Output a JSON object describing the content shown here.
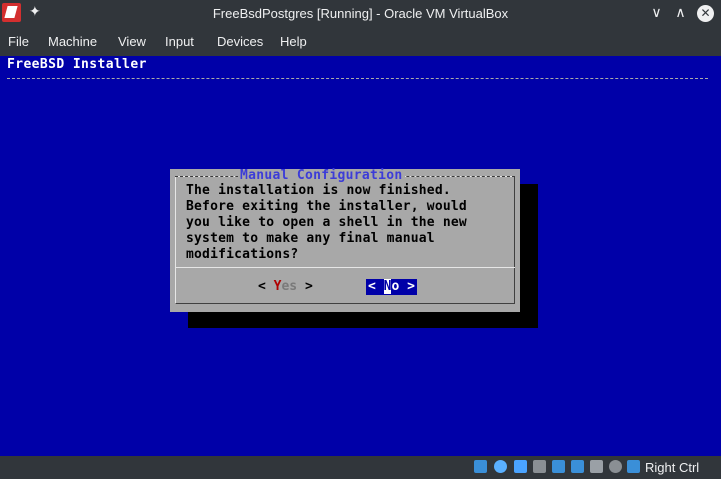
{
  "window": {
    "title": "FreeBsdPostgres [Running] - Oracle VM VirtualBox",
    "min_glyph": "∨",
    "max_glyph": "∧",
    "close_glyph": "✕",
    "pin_glyph": "✦"
  },
  "menu": {
    "items": [
      "File",
      "Machine",
      "View",
      "Input",
      "Devices",
      "Help"
    ]
  },
  "vm": {
    "header": "FreeBSD Installer",
    "dialog": {
      "title": "Manual Configuration",
      "message": "The installation is now finished.\nBefore exiting the installer, would\nyou like to open a shell in the new\nsystem to make any final manual\nmodifications?",
      "yes_open": "<",
      "yes_hot": "Y",
      "yes_rest": "es",
      "yes_close": ">",
      "no_open": "<",
      "no_hot": "N",
      "no_rest": "o",
      "no_close": ">",
      "selected": "No"
    }
  },
  "statusbar": {
    "icons": [
      "hard-disk-icon",
      "optical-drive-icon",
      "usb-icon",
      "shared-folders-icon",
      "display-icon",
      "video-capture-icon",
      "virtualization-icon",
      "mouse-integration-icon",
      "keyboard-capture-icon"
    ],
    "host_key": "Right Ctrl"
  },
  "colors": {
    "vm_background": "#0000a8",
    "dialog_background": "#a8a8a8",
    "chrome": "#31363b"
  }
}
